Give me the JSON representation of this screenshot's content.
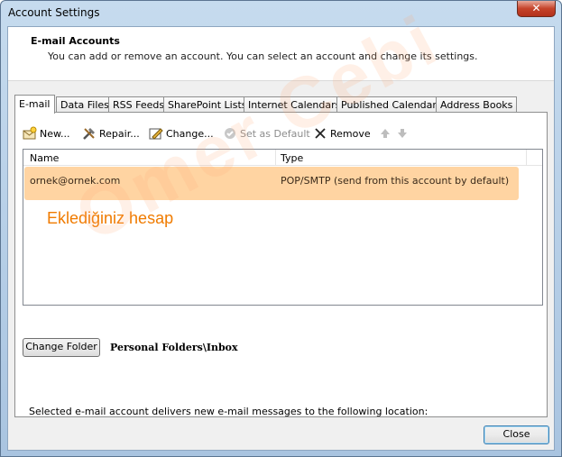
{
  "window": {
    "title": "Account Settings",
    "close_glyph": "✕"
  },
  "header": {
    "title": "E-mail Accounts",
    "description": "You can add or remove an account. You can select an account and change its settings."
  },
  "tabs": [
    {
      "label": "E-mail",
      "active": true
    },
    {
      "label": "Data Files"
    },
    {
      "label": "RSS Feeds"
    },
    {
      "label": "SharePoint Lists"
    },
    {
      "label": "Internet Calendars"
    },
    {
      "label": "Published Calendars"
    },
    {
      "label": "Address Books"
    }
  ],
  "toolbar": {
    "new": "New...",
    "repair": "Repair...",
    "change": "Change...",
    "set_default": "Set as Default",
    "remove": "Remove"
  },
  "list": {
    "columns": {
      "name": "Name",
      "type": "Type"
    },
    "rows": [
      {
        "name": "ornek@ornek.com",
        "type": "POP/SMTP (send from this account by default)"
      }
    ],
    "annotation": "Eklediğiniz hesap"
  },
  "watermark": "Omer Cebi",
  "delivery": {
    "text": "Selected e-mail account delivers new e-mail messages to the following location:",
    "change_folder": "Change Folder",
    "path": "Personal Folders\\Inbox"
  },
  "close_button": "Close",
  "colors": {
    "highlight": "#ffaa46",
    "annotation": "#f07b00"
  }
}
